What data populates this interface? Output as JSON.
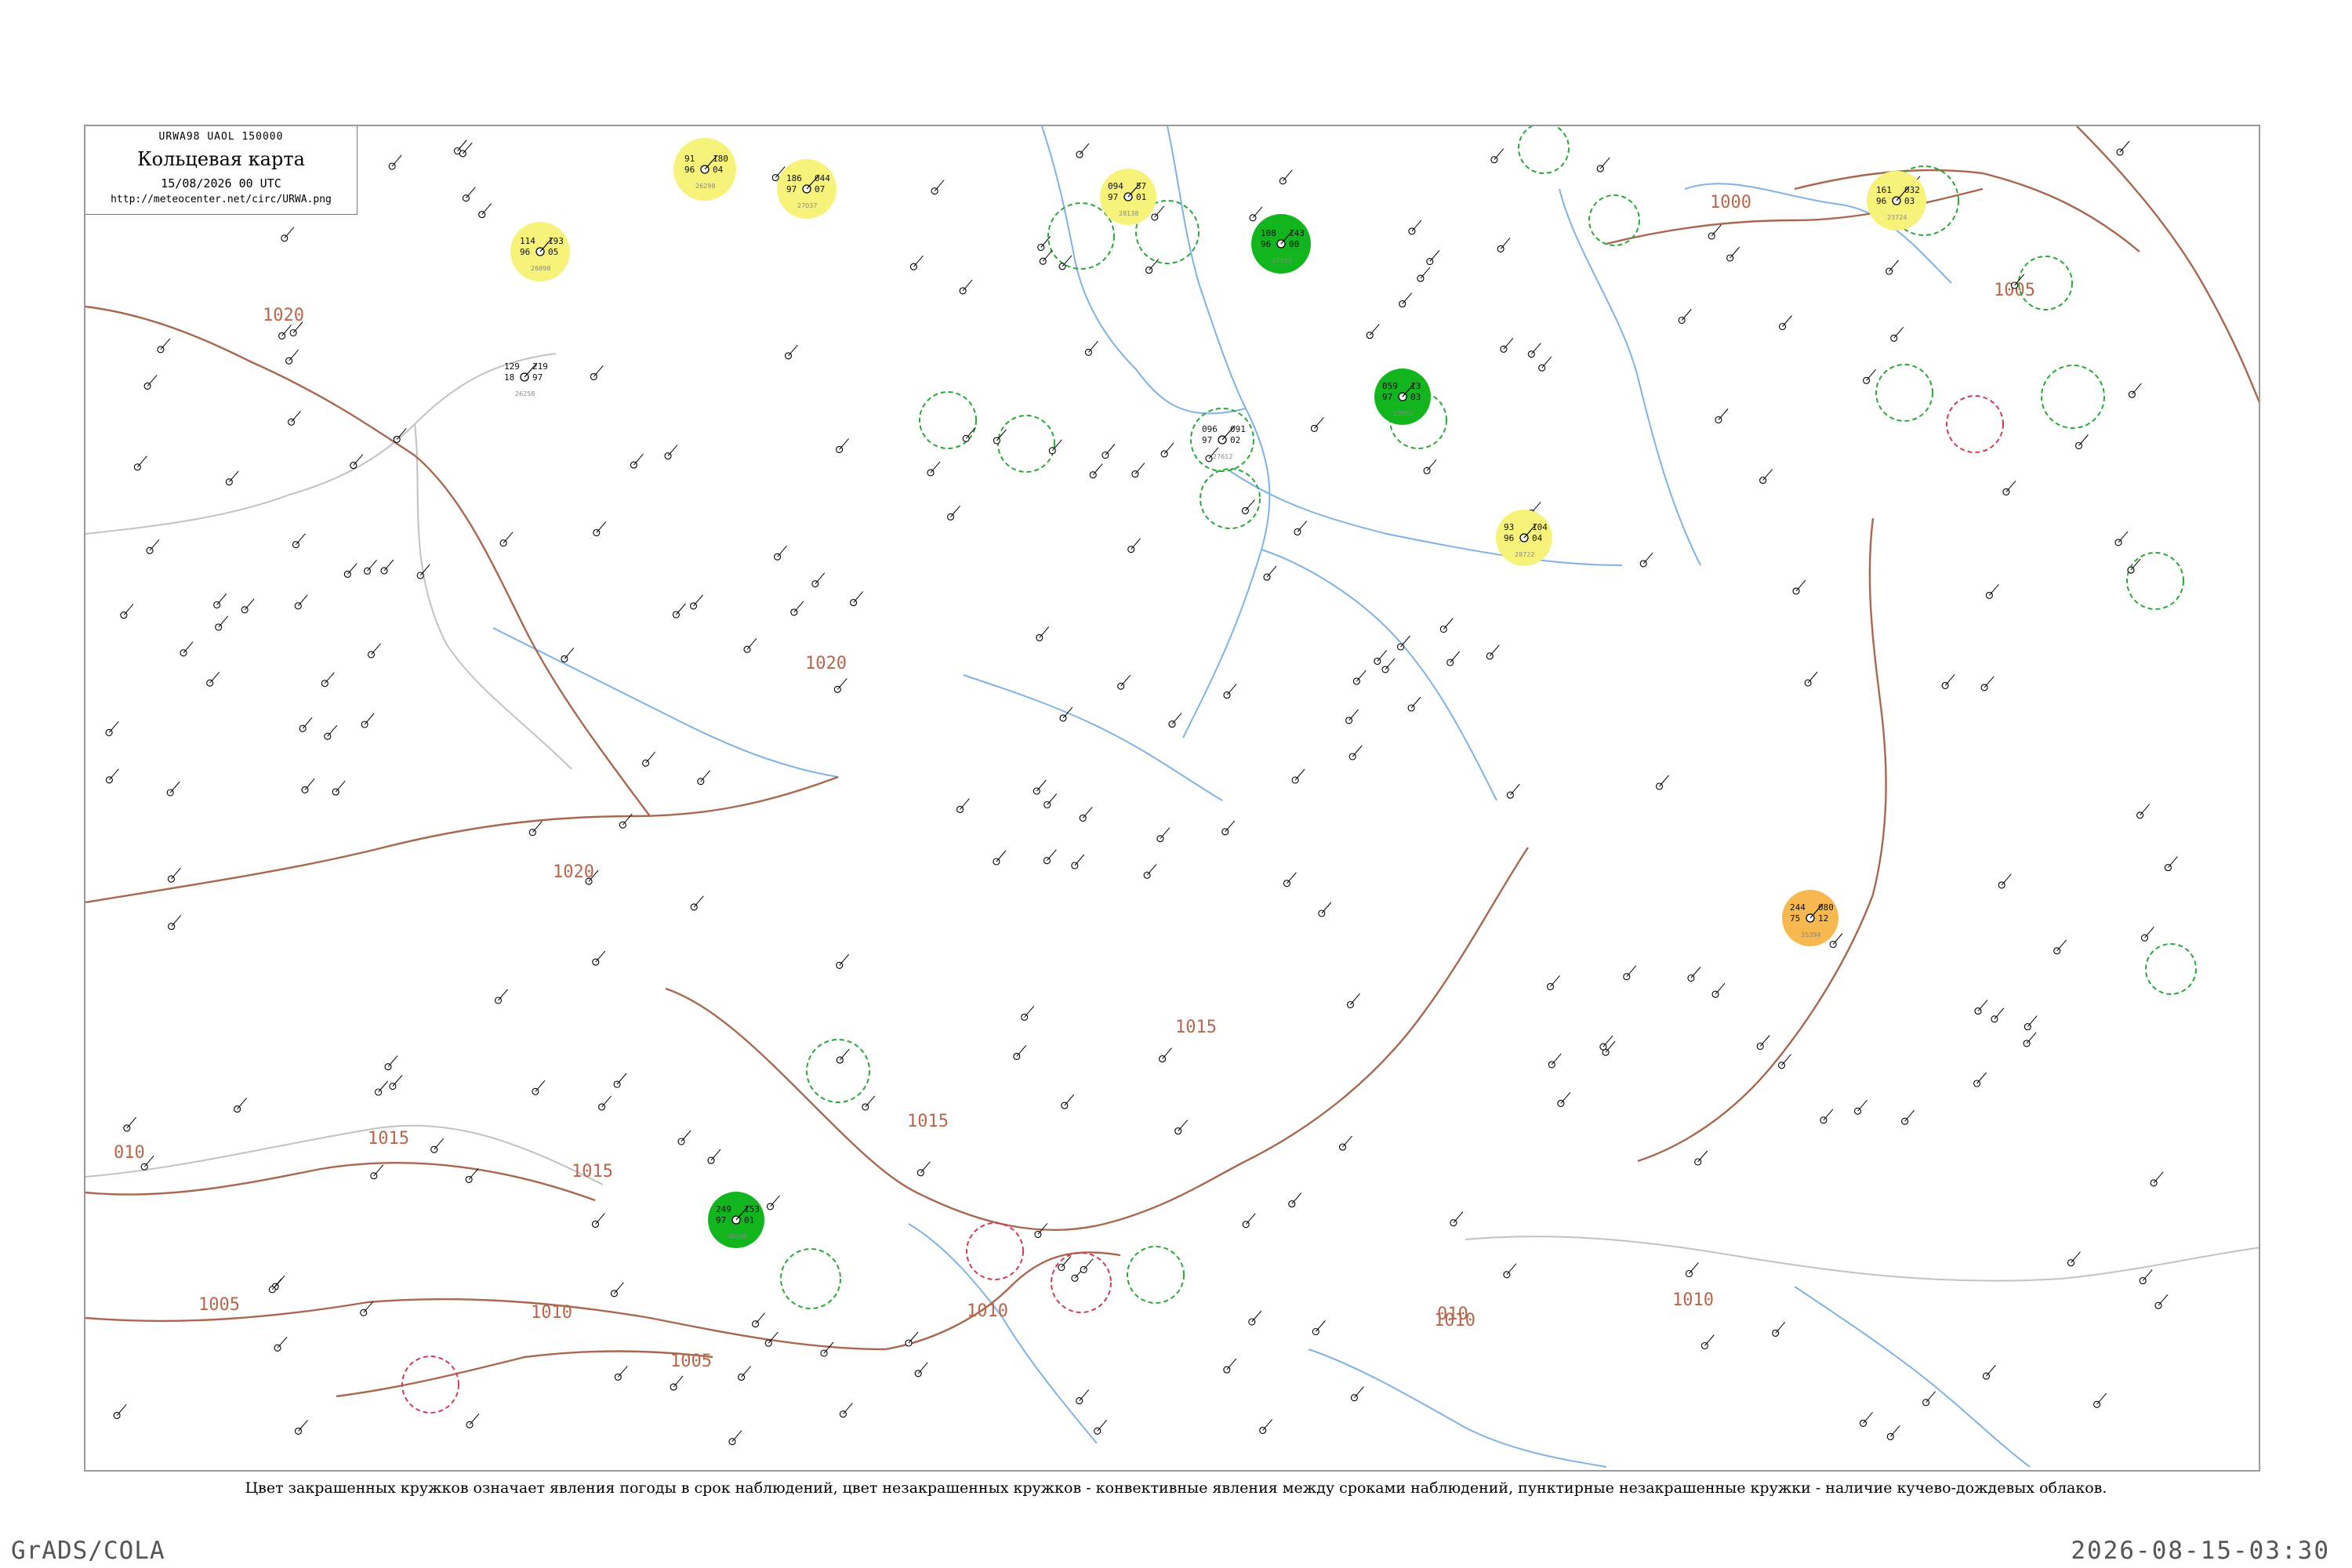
{
  "header": {
    "code": "URWA98  UAOL  150000",
    "title": "Кольцевая карта",
    "datetime": "15/08/2026 00 UTC",
    "url": "http://meteocenter.net/circ/URWA.png"
  },
  "caption": "Цвет закрашенных кружков означает явления погоды в срок наблюдений, цвет незакрашенных кружков - конвективные явления между сроками наблюдений, пунктирные незакрашенные кружки - наличие кучево-дождевых облаков.",
  "footer": {
    "left": "GrADS/COLA",
    "right": "2026-08-15-03:30"
  },
  "colors": {
    "river": "#7fb3e6",
    "border": "#c0c0c0",
    "isobar": "#a8684f",
    "fill_green": "#13b51f",
    "fill_yellow": "#f6f27a",
    "fill_orange": "#f7b850",
    "ring_green": "#2aa838",
    "ring_red": "#d23a55"
  },
  "isobar_labels": [
    "1020",
    "1020",
    "1020",
    "1015",
    "1015",
    "1015",
    "1015",
    "1010",
    "1010",
    "1010",
    "1010",
    "1005",
    "1005",
    "1005",
    "1000",
    "010",
    "010"
  ],
  "stations": [
    {
      "id": "s1",
      "name": "26258",
      "pres": "129",
      "tend": "219",
      "temp": "18",
      "dew": "97",
      "kind": "none"
    },
    {
      "id": "s2",
      "name": "26298",
      "pres": "91",
      "tend": "180",
      "temp": "96",
      "dew": "04",
      "kind": "fill-yellow"
    },
    {
      "id": "s3",
      "name": "27037",
      "pres": "186",
      "tend": "044",
      "temp": "97",
      "dew": "07",
      "kind": "fill-yellow"
    },
    {
      "id": "s4",
      "name": "26898",
      "pres": "114",
      "tend": "193",
      "temp": "96",
      "dew": "05",
      "kind": "fill-yellow"
    },
    {
      "id": "s5",
      "name": "27612",
      "pres": "096",
      "tend": "091",
      "temp": "97",
      "dew": "02",
      "kind": "ring-green"
    },
    {
      "id": "s6",
      "name": "27553",
      "pres": "108",
      "tend": "143",
      "temp": "96",
      "dew": "00",
      "kind": "fill-green"
    },
    {
      "id": "s7",
      "name": "28138",
      "pres": "094",
      "tend": "57",
      "temp": "97",
      "dew": "01",
      "kind": "fill-yellow"
    },
    {
      "id": "s8",
      "name": "23933",
      "pres": "059",
      "tend": "13",
      "temp": "97",
      "dew": "03",
      "kind": "fill-green"
    },
    {
      "id": "s9",
      "name": "28722",
      "pres": "93",
      "tend": "104",
      "temp": "96",
      "dew": "04",
      "kind": "fill-yellow"
    },
    {
      "id": "s10",
      "name": "23724",
      "pres": "161",
      "tend": "032",
      "temp": "96",
      "dew": "03",
      "kind": "fill-yellow"
    },
    {
      "id": "s11",
      "name": "35394",
      "pres": "244",
      "tend": "080",
      "temp": "75",
      "dew": "12",
      "kind": "fill-orange"
    },
    {
      "id": "s12",
      "name": "36096",
      "pres": "249",
      "tend": "153",
      "temp": "97",
      "dew": "01",
      "kind": "fill-green"
    }
  ]
}
